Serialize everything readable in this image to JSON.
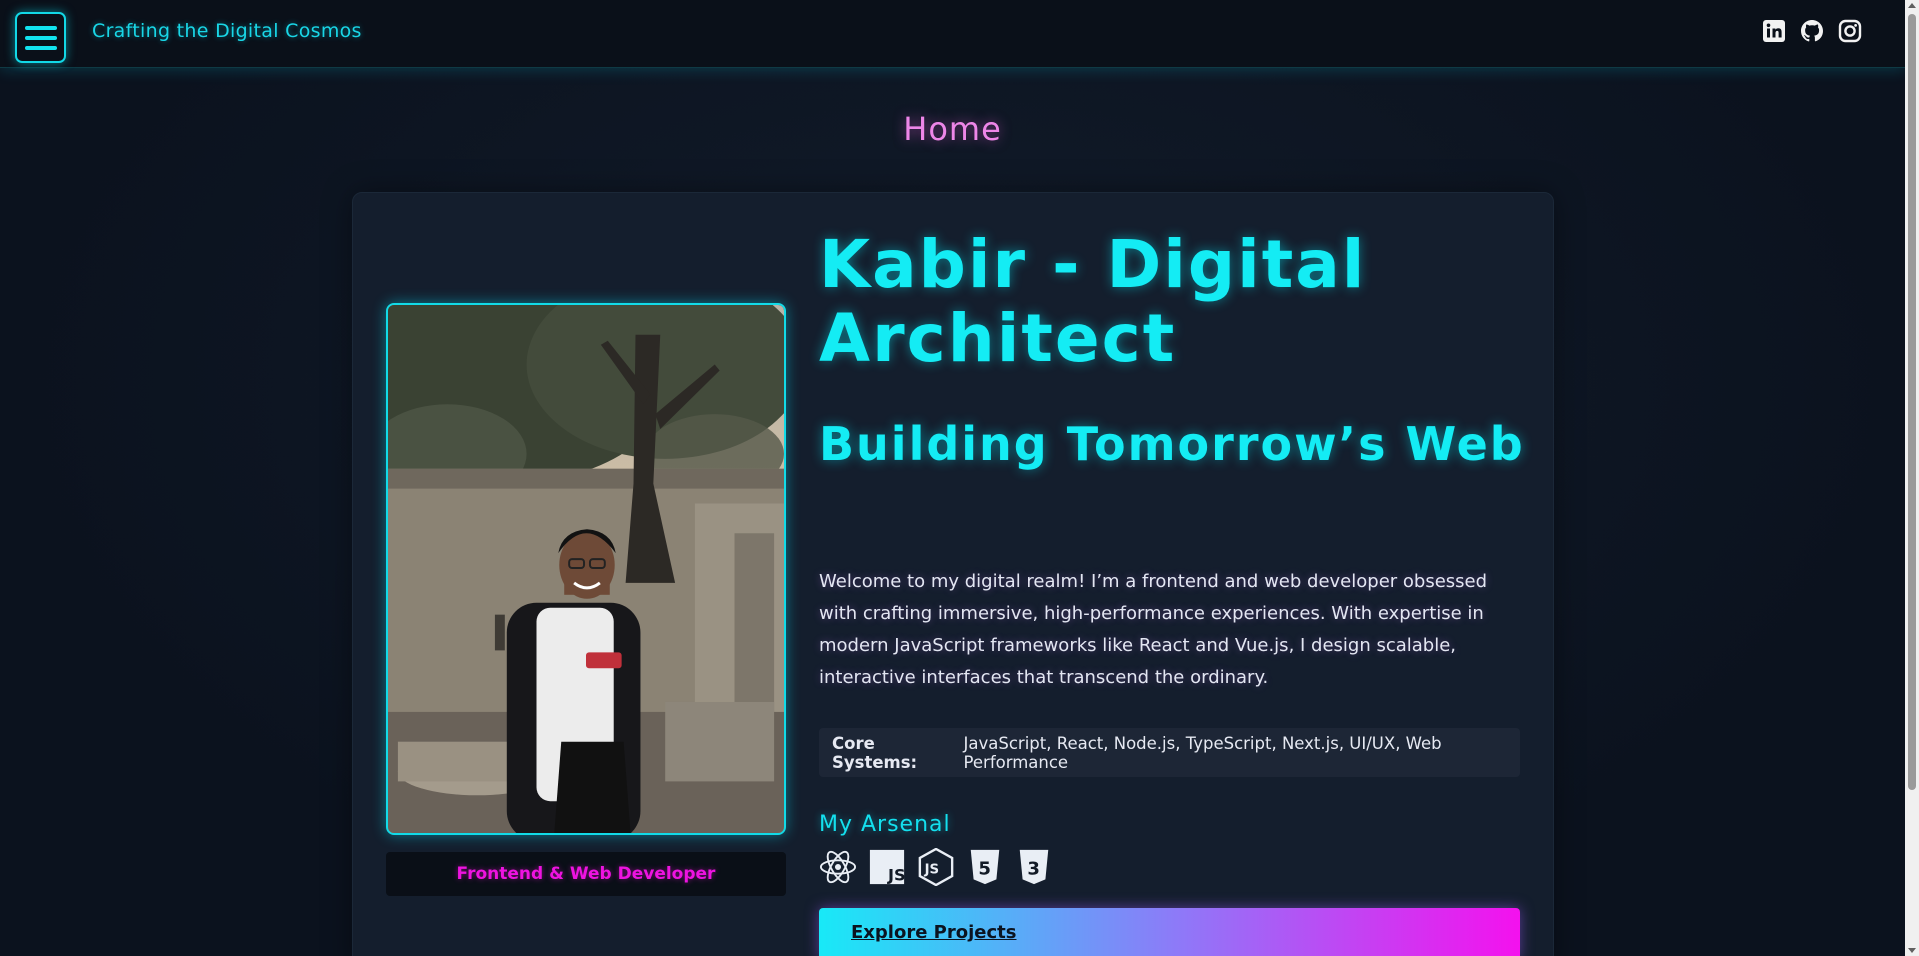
{
  "header": {
    "site_title": "Crafting the Digital Cosmos",
    "menu_icon": "hamburger-menu-icon",
    "socials": [
      {
        "name": "linkedin-icon"
      },
      {
        "name": "github-icon"
      },
      {
        "name": "instagram-icon"
      }
    ]
  },
  "page": {
    "heading": "Home"
  },
  "hero": {
    "title": "Kabir - Digital Architect",
    "subtitle": "Building Tomorrow’s Web",
    "intro": "Welcome to my digital realm! I’m a frontend and web developer obsessed with crafting immersive, high-performance experiences. With expertise in modern JavaScript frameworks like React and Vue.js, I design scalable, interactive interfaces that transcend the ordinary.",
    "core_label": "Core Systems:",
    "core_value": "JavaScript, React, Node.js, TypeScript, Next.js, UI/UX, Web Performance",
    "role_badge": "Frontend & Web Developer",
    "arsenal_title": "My Arsenal",
    "arsenal_icons": [
      "react-icon",
      "javascript-icon",
      "nodejs-icon",
      "html5-icon",
      "css3-icon"
    ],
    "cta_label": "Explore Projects"
  },
  "colors": {
    "accent_cyan": "#14ecf4",
    "accent_magenta": "#ee13e0",
    "heading_pink": "#ee86e8",
    "background": "#0c1320",
    "card": "#141e2d"
  }
}
